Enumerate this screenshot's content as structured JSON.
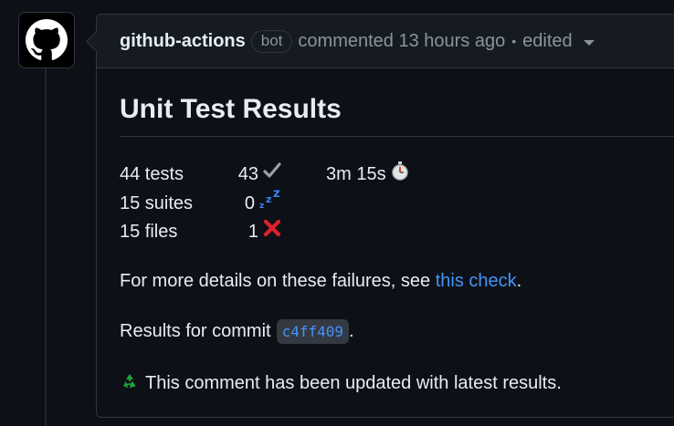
{
  "comment": {
    "author": "github-actions",
    "badge": "bot",
    "action_text": "commented 13 hours ago",
    "dot": "•",
    "edited": "edited"
  },
  "title": "Unit Test Results",
  "stats": {
    "rows": [
      {
        "label": "44 tests",
        "value": "43",
        "icon": "check-icon",
        "extra": "3m 15s",
        "extra_icon": "stopwatch-icon"
      },
      {
        "label": "15 suites",
        "value": "0",
        "icon": "zzz-icon"
      },
      {
        "label": "15 files",
        "value": "1",
        "icon": "red-x-icon"
      }
    ]
  },
  "details": {
    "prefix": "For more details on these failures, see ",
    "link": "this check",
    "suffix": "."
  },
  "commit": {
    "prefix": "Results for commit",
    "sha": "c4ff409",
    "suffix": "."
  },
  "updated_note": "This comment has been updated with latest results.",
  "updated_icon": "recycle-icon",
  "colors": {
    "background": "#0d1117",
    "header": "#161b22",
    "border": "#30363d",
    "link": "#4493f8",
    "text": "#e6edf3",
    "muted": "#8b949e"
  }
}
